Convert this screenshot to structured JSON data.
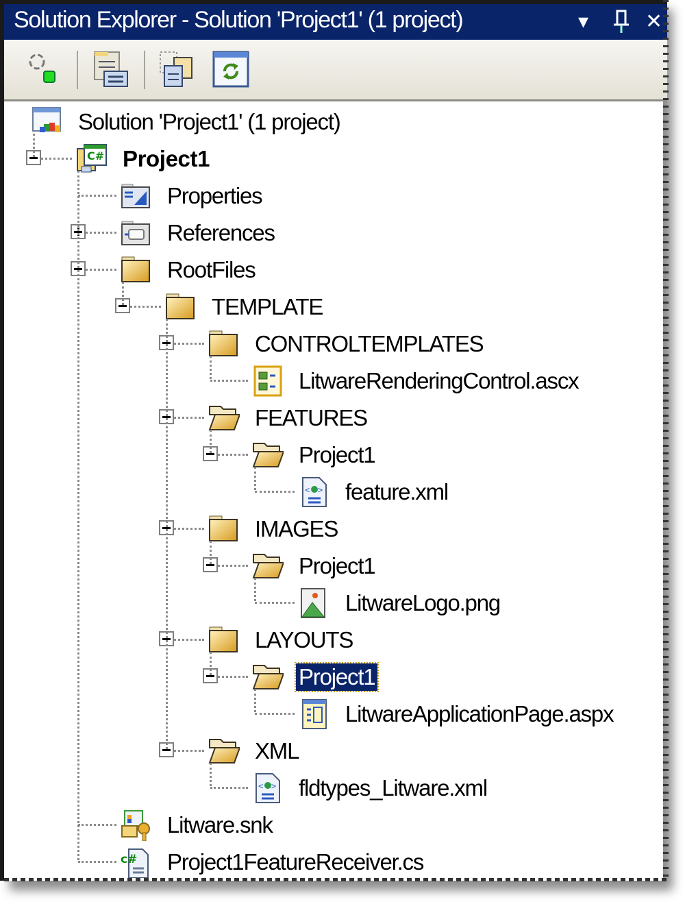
{
  "window": {
    "title": "Solution Explorer - Solution 'Project1' (1 project)",
    "controls": {
      "dropdown_icon": "▾",
      "pin_icon": "⊥",
      "close_icon": "✕"
    }
  },
  "toolbar": {
    "buttons": [
      {
        "name": "refresh-properties",
        "icon": "refresh-green-dot-icon"
      },
      {
        "name": "show-all-files",
        "icon": "show-all-files-icon"
      },
      {
        "name": "copy-website",
        "icon": "copy-icon"
      },
      {
        "name": "refresh",
        "icon": "refresh-icon"
      }
    ]
  },
  "tree": {
    "colors": {
      "selected_bg": "#0a246a",
      "selected_fg": "#ffffff",
      "titlebar_bg": "#0a246a"
    },
    "items": [
      {
        "label": "Solution 'Project1' (1 project)",
        "icon": "solution-icon",
        "level": 0,
        "expander": "none"
      },
      {
        "label": "Project1",
        "icon": "csharp-project-icon",
        "level": 1,
        "expander": "minus",
        "bold": true
      },
      {
        "label": "Properties",
        "icon": "properties-icon",
        "level": 2,
        "expander": "none"
      },
      {
        "label": "References",
        "icon": "references-icon",
        "level": 2,
        "expander": "plus"
      },
      {
        "label": "RootFiles",
        "icon": "folder-closed-icon",
        "level": 2,
        "expander": "minus"
      },
      {
        "label": "TEMPLATE",
        "icon": "folder-closed-icon",
        "level": 3,
        "expander": "minus"
      },
      {
        "label": "CONTROLTEMPLATES",
        "icon": "folder-closed-icon",
        "level": 4,
        "expander": "minus"
      },
      {
        "label": "LitwareRenderingControl.ascx",
        "icon": "user-control-icon",
        "level": 5,
        "expander": "none"
      },
      {
        "label": "FEATURES",
        "icon": "folder-open-icon",
        "level": 4,
        "expander": "minus"
      },
      {
        "label": "Project1",
        "icon": "folder-open-icon",
        "level": 5,
        "expander": "minus"
      },
      {
        "label": "feature.xml",
        "icon": "xml-file-icon",
        "level": 6,
        "expander": "none"
      },
      {
        "label": "IMAGES",
        "icon": "folder-closed-icon",
        "level": 4,
        "expander": "minus"
      },
      {
        "label": "Project1",
        "icon": "folder-open-icon",
        "level": 5,
        "expander": "minus"
      },
      {
        "label": "LitwareLogo.png",
        "icon": "image-file-icon",
        "level": 6,
        "expander": "none"
      },
      {
        "label": "LAYOUTS",
        "icon": "folder-closed-icon",
        "level": 4,
        "expander": "minus"
      },
      {
        "label": "Project1",
        "icon": "folder-open-icon",
        "level": 5,
        "expander": "minus",
        "selected": true
      },
      {
        "label": "LitwareApplicationPage.aspx",
        "icon": "aspx-page-icon",
        "level": 6,
        "expander": "none"
      },
      {
        "label": "XML",
        "icon": "folder-open-icon",
        "level": 4,
        "expander": "minus"
      },
      {
        "label": "fldtypes_Litware.xml",
        "icon": "xml-file-icon",
        "level": 5,
        "expander": "none"
      },
      {
        "label": "Litware.snk",
        "icon": "key-file-icon",
        "level": 2,
        "expander": "none"
      },
      {
        "label": "Project1FeatureReceiver.cs",
        "icon": "csharp-file-icon",
        "level": 2,
        "expander": "none"
      }
    ]
  }
}
